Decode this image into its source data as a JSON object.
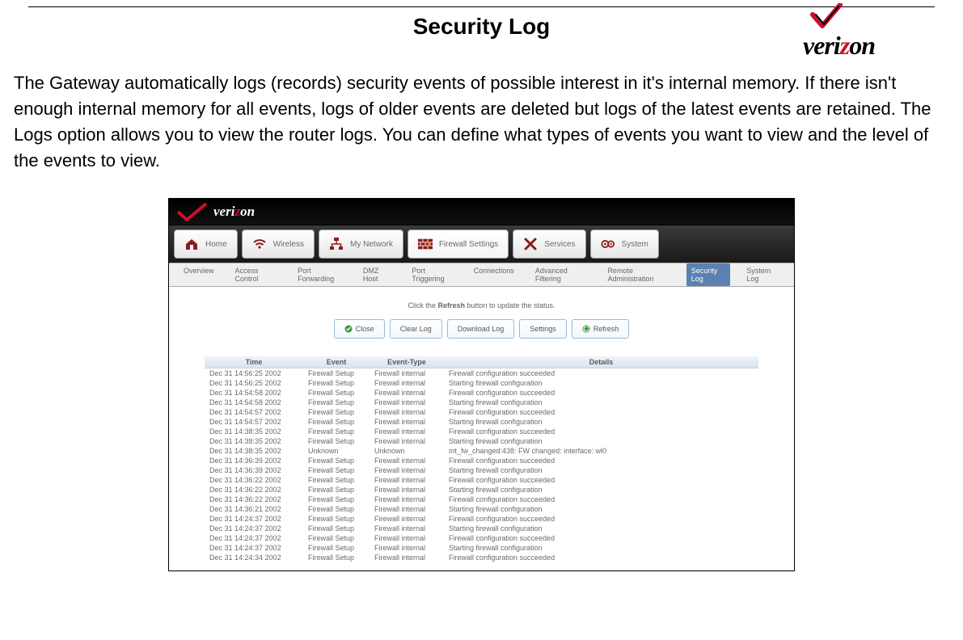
{
  "doc": {
    "title": "Security Log",
    "topLogoText": "verizon",
    "description": "The Gateway automatically logs (records) security events of possible interest in it's internal memory. If there isn't enough internal memory for all events, logs of older events are deleted but logs of the latest events are retained. The Logs option allows you to view the router logs. You can define what types of events you want to view and the level of the events to view."
  },
  "router": {
    "logoText": "verizon",
    "mainTabs": [
      {
        "icon": "home",
        "label": "Home"
      },
      {
        "icon": "wifi",
        "label": "Wireless"
      },
      {
        "icon": "network",
        "label": "My Network"
      },
      {
        "icon": "firewall",
        "label": "Firewall Settings",
        "selected": true
      },
      {
        "icon": "tools",
        "label": "Services"
      },
      {
        "icon": "gears",
        "label": "System"
      }
    ],
    "subTabs": [
      {
        "label": "Overview"
      },
      {
        "label": "Access Control"
      },
      {
        "label": "Port Forwarding"
      },
      {
        "label": "DMZ Host"
      },
      {
        "label": "Port Triggering"
      },
      {
        "label": "Connections"
      },
      {
        "label": "Advanced Filtering"
      },
      {
        "label": "Remote Administration"
      },
      {
        "label": "Security Log",
        "active": true
      },
      {
        "label": "System Log"
      }
    ],
    "hint_pre": "Click the ",
    "hint_bold": "Refresh",
    "hint_post": " button to update the status.",
    "actions": {
      "close": "Close",
      "clear": "Clear Log",
      "download": "Download Log",
      "settings": "Settings",
      "refresh": "Refresh"
    },
    "columns": {
      "time": "Time",
      "event": "Event",
      "eventType": "Event-Type",
      "details": "Details"
    },
    "log": [
      {
        "time": "Dec 31 14:56:25 2002",
        "event": "Firewall Setup",
        "type": "Firewall internal",
        "details": "Firewall configuration succeeded"
      },
      {
        "time": "Dec 31 14:56:25 2002",
        "event": "Firewall Setup",
        "type": "Firewall internal",
        "details": "Starting firewall configuration"
      },
      {
        "time": "Dec 31 14:54:58 2002",
        "event": "Firewall Setup",
        "type": "Firewall internal",
        "details": "Firewall configuration succeeded"
      },
      {
        "time": "Dec 31 14:54:58 2002",
        "event": "Firewall Setup",
        "type": "Firewall internal",
        "details": "Starting firewall configuration"
      },
      {
        "time": "Dec 31 14:54:57 2002",
        "event": "Firewall Setup",
        "type": "Firewall internal",
        "details": "Firewall configuration succeeded"
      },
      {
        "time": "Dec 31 14:54:57 2002",
        "event": "Firewall Setup",
        "type": "Firewall internal",
        "details": "Starting firewall configuration"
      },
      {
        "time": "Dec 31 14:38:35 2002",
        "event": "Firewall Setup",
        "type": "Firewall internal",
        "details": "Firewall configuration succeeded"
      },
      {
        "time": "Dec 31 14:38:35 2002",
        "event": "Firewall Setup",
        "type": "Firewall internal",
        "details": "Starting firewall configuration"
      },
      {
        "time": "Dec 31 14:38:35 2002",
        "event": "Unknown",
        "type": "Unknown",
        "details": "mt_fw_changed:438: FW changed: interface: wl0"
      },
      {
        "time": "Dec 31 14:36:39 2002",
        "event": "Firewall Setup",
        "type": "Firewall internal",
        "details": "Firewall configuration succeeded"
      },
      {
        "time": "Dec 31 14:36:39 2002",
        "event": "Firewall Setup",
        "type": "Firewall internal",
        "details": "Starting firewall configuration"
      },
      {
        "time": "Dec 31 14:36:22 2002",
        "event": "Firewall Setup",
        "type": "Firewall internal",
        "details": "Firewall configuration succeeded"
      },
      {
        "time": "Dec 31 14:36:22 2002",
        "event": "Firewall Setup",
        "type": "Firewall internal",
        "details": "Starting firewall configuration"
      },
      {
        "time": "Dec 31 14:36:22 2002",
        "event": "Firewall Setup",
        "type": "Firewall internal",
        "details": "Firewall configuration succeeded"
      },
      {
        "time": "Dec 31 14:36:21 2002",
        "event": "Firewall Setup",
        "type": "Firewall internal",
        "details": "Starting firewall configuration"
      },
      {
        "time": "Dec 31 14:24:37 2002",
        "event": "Firewall Setup",
        "type": "Firewall internal",
        "details": "Firewall configuration succeeded"
      },
      {
        "time": "Dec 31 14:24:37 2002",
        "event": "Firewall Setup",
        "type": "Firewall internal",
        "details": "Starting firewall configuration"
      },
      {
        "time": "Dec 31 14:24:37 2002",
        "event": "Firewall Setup",
        "type": "Firewall internal",
        "details": "Firewall configuration succeeded"
      },
      {
        "time": "Dec 31 14:24:37 2002",
        "event": "Firewall Setup",
        "type": "Firewall internal",
        "details": "Starting firewall configuration"
      },
      {
        "time": "Dec 31 14:24:34 2002",
        "event": "Firewall Setup",
        "type": "Firewall internal",
        "details": "Firewall configuration succeeded"
      }
    ]
  }
}
